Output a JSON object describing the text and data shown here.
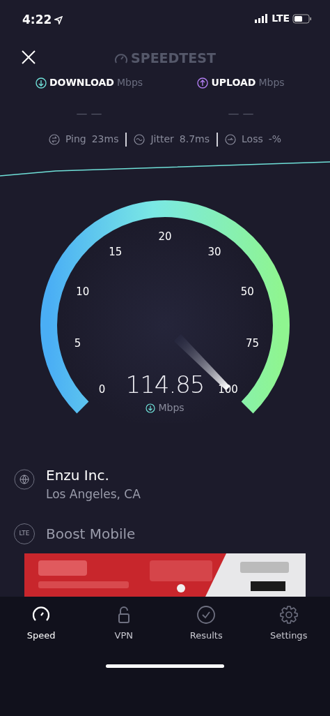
{
  "status_bar": {
    "time": "4:22",
    "network": "LTE"
  },
  "header": {
    "logo": "SPEEDTEST"
  },
  "results": [
    {
      "kind": "download",
      "label": "DOWNLOAD",
      "unit": "Mbps",
      "value": "— —"
    },
    {
      "kind": "upload",
      "label": "UPLOAD",
      "unit": "Mbps",
      "value": "— —"
    }
  ],
  "metrics": [
    {
      "kind": "ping",
      "label": "Ping",
      "value": "23ms"
    },
    {
      "kind": "jitter",
      "label": "Jitter",
      "value": "8.7ms"
    },
    {
      "kind": "loss",
      "label": "Loss",
      "value": "-%"
    }
  ],
  "gauge": {
    "scale": [
      "0",
      "5",
      "10",
      "15",
      "20",
      "30",
      "50",
      "75",
      "100"
    ],
    "reading": "114.85",
    "unit": "Mbps"
  },
  "server": {
    "name": "Enzu Inc.",
    "location": "Los Angeles, CA"
  },
  "provider": {
    "badge": "LTE",
    "name": "Boost Mobile"
  },
  "tabs": [
    {
      "kind": "speed",
      "label": "Speed",
      "selected": true
    },
    {
      "kind": "vpn",
      "label": "VPN",
      "selected": false
    },
    {
      "kind": "results",
      "label": "Results",
      "selected": false
    },
    {
      "kind": "settings",
      "label": "Settings",
      "selected": false
    }
  ]
}
